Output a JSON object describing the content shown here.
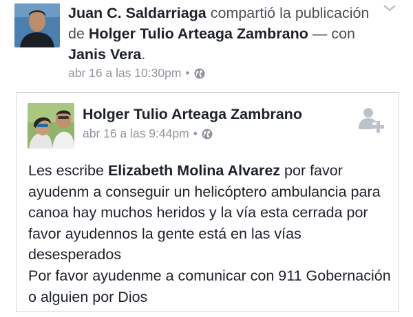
{
  "share": {
    "sharer_name": "Juan C. Saldarriaga",
    "shared_text": "compartió la publicación de",
    "original_author": "Holger Tulio Arteaga Zambrano",
    "with_text": "— con",
    "tagged_name": "Janis Vera",
    "period": ".",
    "timestamp": "abr 16 a las 10:30pm",
    "separator": "•",
    "privacy_icon": "globe-icon",
    "menu_icon": "chevron-down-icon"
  },
  "post": {
    "author": "Holger Tulio Arteaga Zambrano",
    "timestamp": "abr 16 a las 9:44pm",
    "separator": "•",
    "privacy_icon": "globe-icon",
    "action_icon": "add-friend-icon",
    "body_prefix": "Les escribe",
    "body_bold": "Elizabeth Molina Alvarez",
    "body_rest": "por favor ayudenm a conseguir un helicóptero ambulancia para canoa hay muchos heridos y la vía esta cerrada por favor ayudennos la gente está en las vías desesperados",
    "body_line2": "Por favor ayudenme a comunicar con 911 Gobernación o alguien por Dios"
  },
  "colors": {
    "text": "#1d2129",
    "secondary": "#90949c",
    "border": "#d3d6db",
    "icon_gray": "#bdc1c9"
  }
}
